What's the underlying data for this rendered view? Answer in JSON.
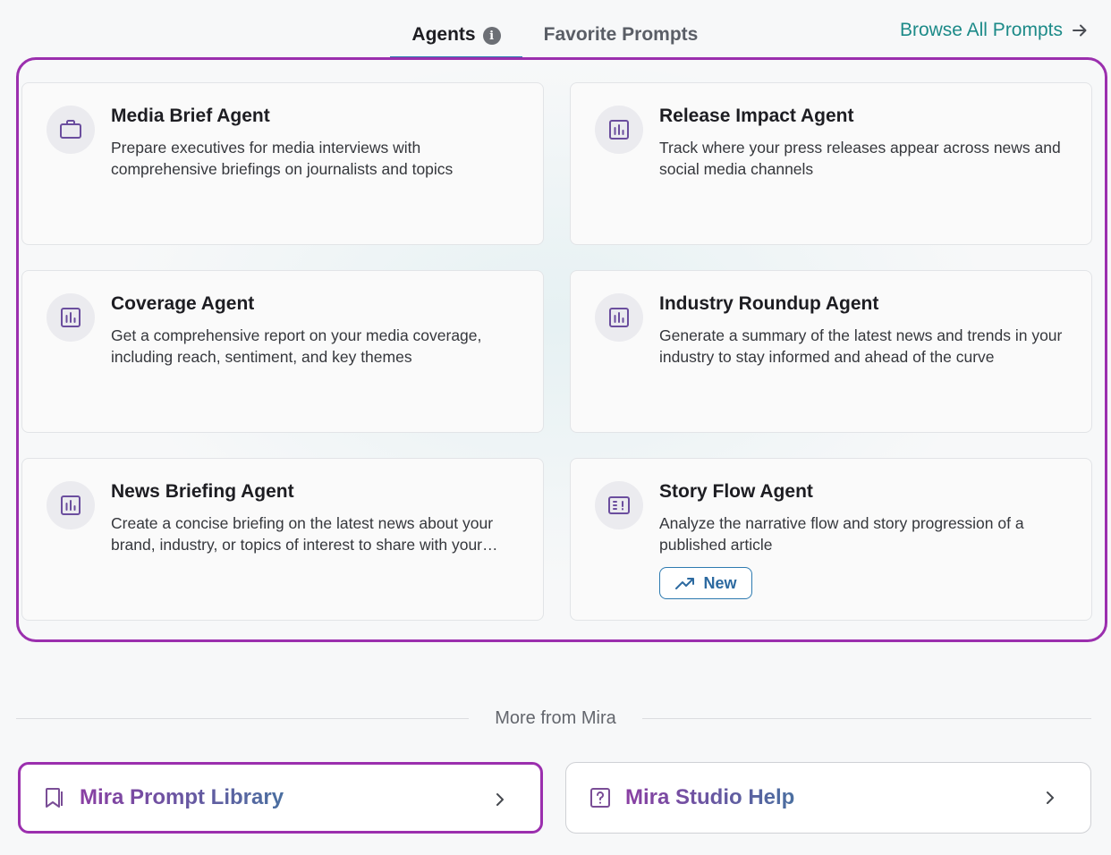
{
  "tabs": {
    "agents_label": "Agents",
    "favorites_label": "Favorite Prompts",
    "info_icon": "info-icon",
    "browse_label": "Browse All Prompts",
    "browse_icon": "arrow-right-icon"
  },
  "agents": [
    {
      "title": "Media Brief Agent",
      "description": "Prepare executives for media interviews with comprehensive briefings on journalists and topics",
      "icon": "briefcase-icon"
    },
    {
      "title": "Release Impact Agent",
      "description": "Track where your press releases appear across news and social media channels",
      "icon": "bar-chart-icon"
    },
    {
      "title": "Coverage Agent",
      "description": "Get a comprehensive report on your media coverage, including reach, sentiment, and key themes",
      "icon": "bar-chart-icon"
    },
    {
      "title": "Industry Roundup Agent",
      "description": "Generate a summary of the latest news and trends in your industry to stay informed and ahead of the curve",
      "icon": "bar-chart-icon"
    },
    {
      "title": "News Briefing Agent",
      "description": "Create a concise briefing on the latest news about your brand, industry, or topics of interest to share with your stakeholders",
      "icon": "bar-chart-icon"
    },
    {
      "title": "Story Flow Agent",
      "description": "Analyze the narrative flow and story progression of a published article",
      "icon": "story-flow-icon",
      "badge": "New",
      "badge_icon": "trending-up-icon"
    }
  ],
  "more": {
    "label": "More from Mira",
    "links": [
      {
        "label": "Mira Prompt Library",
        "icon": "bookmark-icon"
      },
      {
        "label": "Mira Studio Help",
        "icon": "help-square-icon"
      }
    ],
    "chevron_icon": "chevron-right-icon"
  },
  "colors": {
    "accent_teal": "#1c8a88",
    "highlight_purple": "#9b2fae",
    "icon_purple": "#6b4e9e",
    "badge_blue": "#2d7ab0"
  }
}
